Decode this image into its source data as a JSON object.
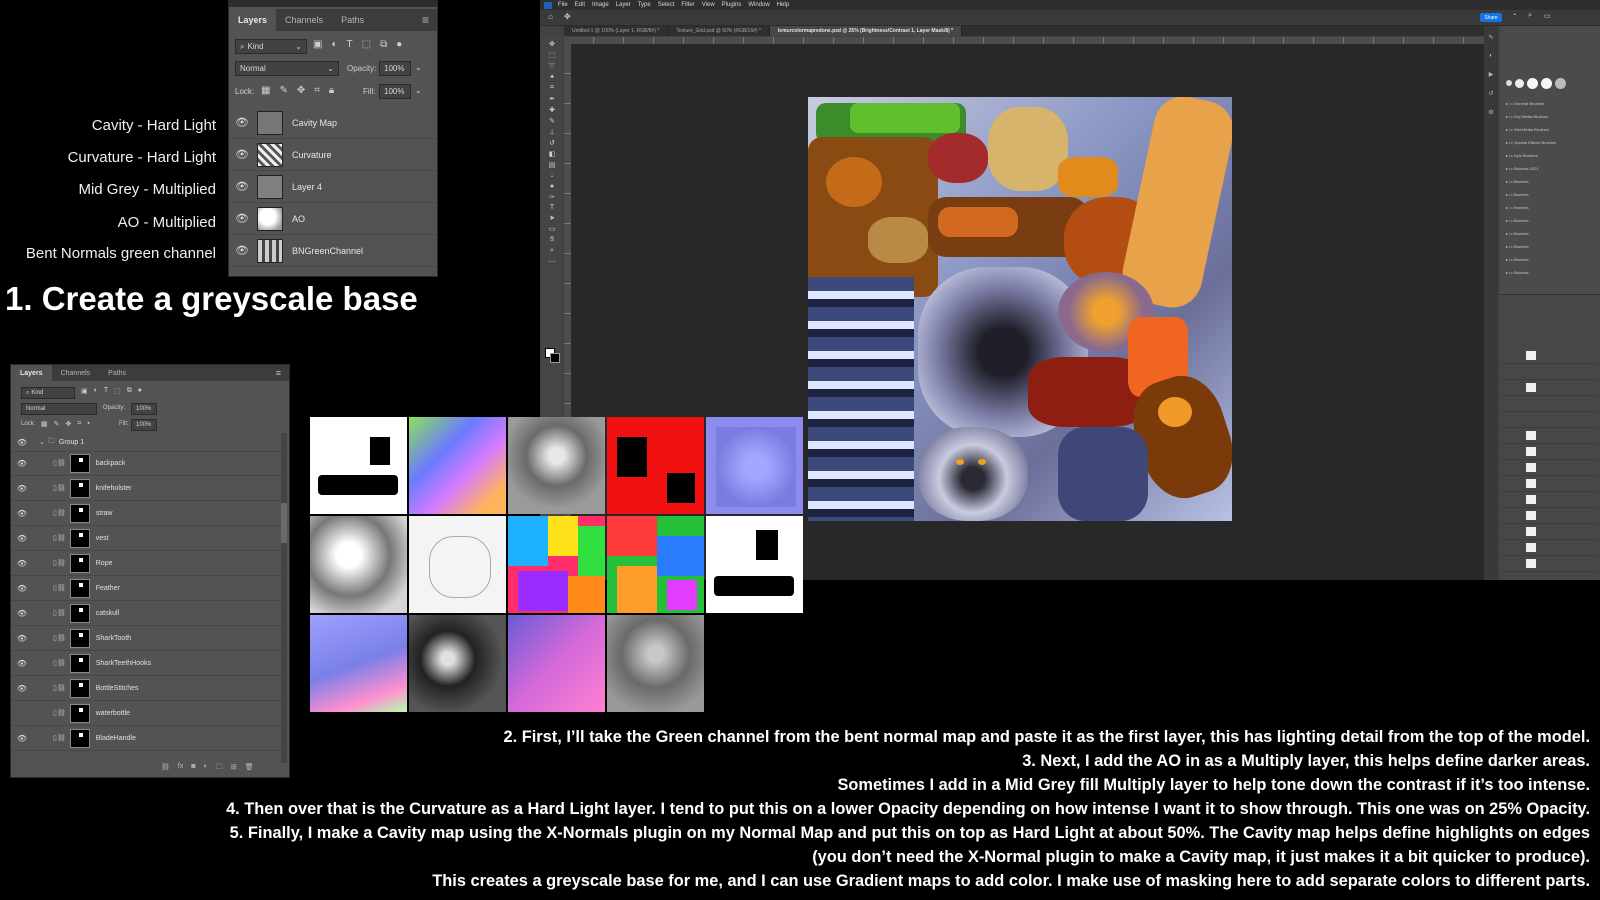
{
  "layer_labels": [
    "Cavity - Hard Light",
    "Curvature - Hard Light",
    "Mid Grey - Multiplied",
    "AO - Multiplied",
    "Bent Normals green channel"
  ],
  "heading": "1. Create a greyscale base",
  "panel1": {
    "tabs": [
      "Layers",
      "Channels",
      "Paths"
    ],
    "filter_kind": "Kind",
    "blend_mode": "Normal",
    "opacity_label": "Opacity:",
    "opacity_value": "100%",
    "lock_label": "Lock:",
    "fill_label": "Fill:",
    "fill_value": "100%",
    "layers": [
      "Cavity Map",
      "Curvature",
      "Layer 4",
      "AO",
      "BNGreenChannel"
    ]
  },
  "panel2": {
    "tabs": [
      "Layers",
      "Channels",
      "Paths"
    ],
    "filter_kind": "Kind",
    "blend_mode": "Normal",
    "opacity_label": "Opacity:",
    "opacity_value": "100%",
    "lock_label": "Lock:",
    "fill_label": "Fill:",
    "fill_value": "100%",
    "group_name": "Group 1",
    "layers": [
      "backpack",
      "knifeholster",
      "straw",
      "vest",
      "Rope",
      "Feather",
      "catskull",
      "SharkTooth",
      "SharkTeethHooks",
      "BottleStitches",
      "waterbottle",
      "BladeHandle"
    ]
  },
  "photoshop": {
    "menu": [
      "File",
      "Edit",
      "Image",
      "Layer",
      "Type",
      "Select",
      "Filter",
      "View",
      "Plugins",
      "Window",
      "Help"
    ],
    "doc_tabs": [
      "Untitled-1 @ 100% (Layer 1, RGB/8#) *",
      "Texture_Grid.psd @ 50% (RGB/16#) *",
      "lemurcolormapredone.psd @ 25% (Brightness/Contrast 1, Layer Mask/8) *"
    ],
    "share_label": "Share"
  },
  "instructions": [
    "2. First, I’ll take the Green channel from the bent normal map and paste it as the first layer, this has lighting detail from the top of the model.",
    "3. Next, I add the AO in as a Multiply layer, this helps define darker areas.",
    "Sometimes I add in a Mid Grey fill Multiply layer to help tone down the contrast if it’s too intense.",
    "4. Then over that is the Curvature as a Hard Light layer. I tend to put this on a lower Opacity depending on how intense I want it to show through. This one was on 25% Opacity.",
    "5. Finally, I make a Cavity map using the X-Normals plugin on my Normal Map and put this on top as Hard Light at about 50%. The Cavity map helps define highlights on edges",
    "(you don’t need the X-Normal plugin to make a Cavity map, it just makes it a bit quicker to produce).",
    "This creates a greyscale base for me, and I can use Gradient maps to add color. I make use of masking here to add separate colors to different parts."
  ]
}
